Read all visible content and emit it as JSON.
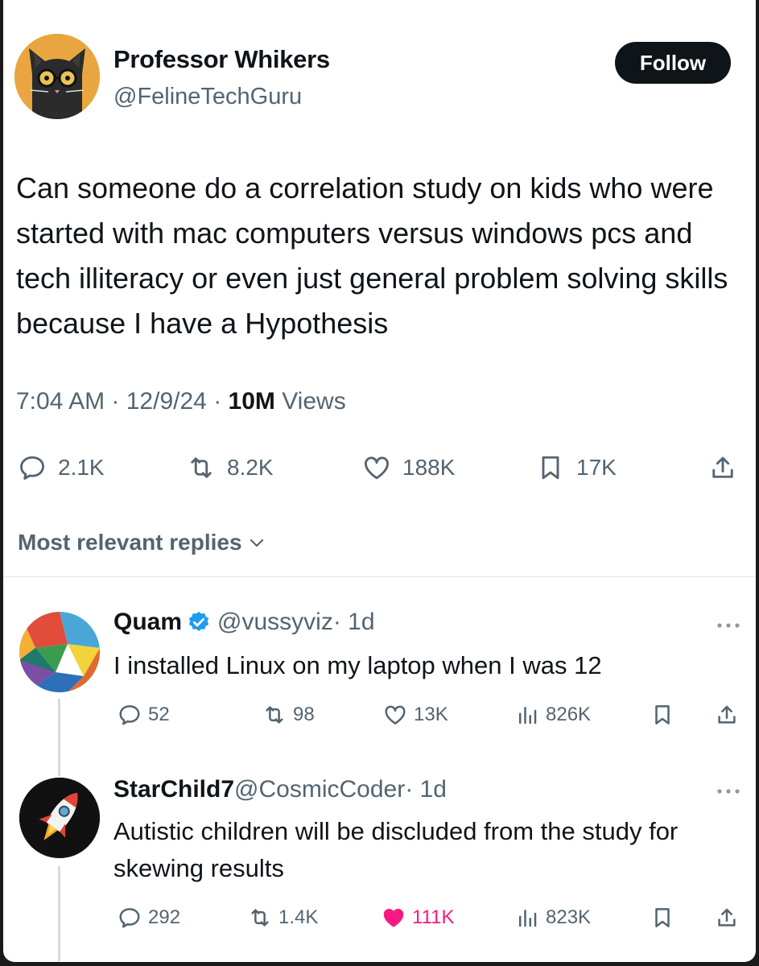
{
  "tweet": {
    "author": {
      "display_name": "Professor Whikers",
      "handle": "@FelineTechGuru",
      "avatar_icon": "cat-with-glasses-avatar"
    },
    "follow_label": "Follow",
    "text": "Can someone do a correlation study on kids who were started with mac computers versus windows pcs and tech illiteracy or even just general problem solving skills because I have a Hypothesis",
    "time": "7:04 AM",
    "date": "12/9/24",
    "views_count": "10M",
    "views_label": "Views",
    "separator": "·",
    "stats": {
      "replies": "2.1K",
      "reposts": "8.2K",
      "likes": "188K",
      "bookmarks": "17K"
    }
  },
  "replies_sort": {
    "label": "Most relevant replies"
  },
  "replies": [
    {
      "display_name": "Quam",
      "verified": true,
      "handle": "@vussyviz",
      "age": "· 1d",
      "text": "I installed Linux on my laptop when I was 12",
      "avatar_icon": "geometric-polygon-avatar",
      "stats": {
        "replies": "52",
        "reposts": "98",
        "likes": "13K",
        "views": "826K"
      },
      "liked": false
    },
    {
      "display_name": "StarChild7",
      "verified": false,
      "handle": "@CosmicCoder",
      "age": "· 1d",
      "text": "Autistic children will be discluded from the study for skewing results",
      "avatar_icon": "rocket-avatar",
      "stats": {
        "replies": "292",
        "reposts": "1.4K",
        "likes": "111K",
        "views": "823K"
      },
      "liked": true
    }
  ],
  "colors": {
    "text": "#0f1419",
    "muted": "#536471",
    "follow_bg": "#0f1419",
    "like_active": "#f91880",
    "verified": "#1d9bf0"
  }
}
